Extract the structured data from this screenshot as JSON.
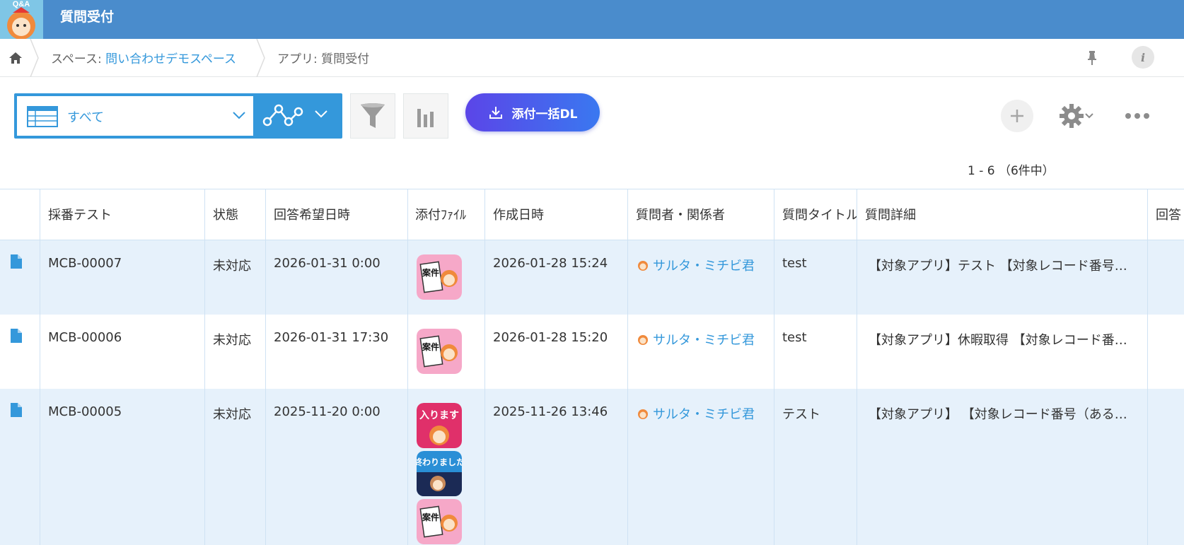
{
  "header": {
    "app_title": "質問受付",
    "logo_text": "Q&A"
  },
  "breadcrumb": {
    "space_prefix": "スペース: ",
    "space_name": "問い合わせデモスペース",
    "app_label": "アプリ: 質問受付"
  },
  "toolbar": {
    "view_name": "すべて",
    "download_label": "添付一括DL"
  },
  "pager": {
    "text": "1 - 6 （6件中）"
  },
  "table": {
    "columns": [
      "採番テスト",
      "状態",
      "回答希望日時",
      "添付ﾌｧｲﾙ",
      "作成日時",
      "質問者・関係者",
      "質問タイトル",
      "質問詳細",
      "回答"
    ],
    "rows": [
      {
        "number": "MCB-00007",
        "status": "未対応",
        "due": "2026-01-31 0:00",
        "attachments": [
          "案件"
        ],
        "created": "2026-01-28 15:24",
        "user": "サルタ・ミチビ君",
        "title": "test",
        "detail": "【対象アプリ】テスト 【対象レコード番号…"
      },
      {
        "number": "MCB-00006",
        "status": "未対応",
        "due": "2026-01-31 17:30",
        "attachments": [
          "案件"
        ],
        "created": "2026-01-28 15:20",
        "user": "サルタ・ミチビ君",
        "title": "test",
        "detail": "【対象アプリ】休暇取得 【対象レコード番…"
      },
      {
        "number": "MCB-00005",
        "status": "未対応",
        "due": "2025-11-20 0:00",
        "attachments": [
          "入ります",
          "終わりました",
          "案件"
        ],
        "created": "2025-11-26 13:46",
        "user": "サルタ・ミチビ君",
        "title": "テスト",
        "detail": "【対象アプリ】 【対象レコード番号（ある…"
      }
    ]
  },
  "colors": {
    "header_bg": "#4a8ccc",
    "accent": "#3498db",
    "row_shade": "#e6f1fb",
    "download_gradient_start": "#5b45e8",
    "download_gradient_end": "#3a78f0"
  },
  "icons": [
    "home-icon",
    "pin-icon",
    "info-icon",
    "table-view-icon",
    "chevron-down-icon",
    "graph-icon",
    "filter-icon",
    "bar-chart-icon",
    "download-icon",
    "plus-icon",
    "gear-icon",
    "more-icon",
    "document-icon",
    "user-avatar-icon"
  ]
}
